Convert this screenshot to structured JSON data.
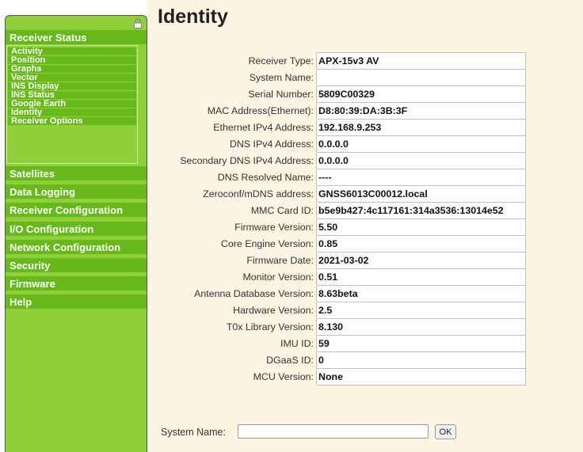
{
  "page": {
    "title": "Identity"
  },
  "sidebar": {
    "lock_icon": "lock-icon",
    "receiver_status": {
      "label": "Receiver Status",
      "items": [
        "Activity",
        "Position",
        "Graphs",
        "Vector",
        "INS Display",
        "INS Status",
        "Google Earth",
        "Identity",
        "Receiver Options"
      ]
    },
    "sections": [
      "Satellites",
      "Data Logging",
      "Receiver Configuration",
      "I/O Configuration",
      "Network Configuration",
      "Security",
      "Firmware",
      "Help"
    ]
  },
  "identity": {
    "rows": [
      {
        "label": "Receiver Type:",
        "value": "APX-15v3 AV"
      },
      {
        "label": "System Name:",
        "value": ""
      },
      {
        "label": "Serial Number:",
        "value": "5809C00329"
      },
      {
        "label": "MAC Address(Ethernet):",
        "value": "D8:80:39:DA:3B:3F"
      },
      {
        "label": "Ethernet IPv4 Address:",
        "value": "192.168.9.253"
      },
      {
        "label": "DNS IPv4 Address:",
        "value": "0.0.0.0"
      },
      {
        "label": "Secondary DNS IPv4 Address:",
        "value": "0.0.0.0"
      },
      {
        "label": "DNS Resolved Name:",
        "value": "----"
      },
      {
        "label": "Zeroconf/mDNS address:",
        "value": "GNSS6013C00012.local"
      },
      {
        "label": "MMC Card ID:",
        "value": "b5e9b427:4c117161:314a3536:13014e52"
      },
      {
        "label": "Firmware Version:",
        "value": "5.50"
      },
      {
        "label": "Core Engine Version:",
        "value": "0.85"
      },
      {
        "label": "Firmware Date:",
        "value": "2021-03-02"
      },
      {
        "label": "Monitor Version:",
        "value": "0.51"
      },
      {
        "label": "Antenna Database Version:",
        "value": "8.63beta"
      },
      {
        "label": "Hardware Version:",
        "value": "2.5"
      },
      {
        "label": "T0x Library Version:",
        "value": "8.130"
      },
      {
        "label": "IMU ID:",
        "value": "59"
      },
      {
        "label": "DGaaS ID:",
        "value": "0"
      },
      {
        "label": "MCU Version:",
        "value": "None"
      }
    ]
  },
  "form": {
    "system_name_label": "System Name:",
    "system_name_value": "",
    "ok_label": "OK"
  },
  "colors": {
    "sidebar_bg": "#8fcf3a",
    "nav_item_bg": "#66b81b",
    "content_bg": "#fcf5e3"
  }
}
